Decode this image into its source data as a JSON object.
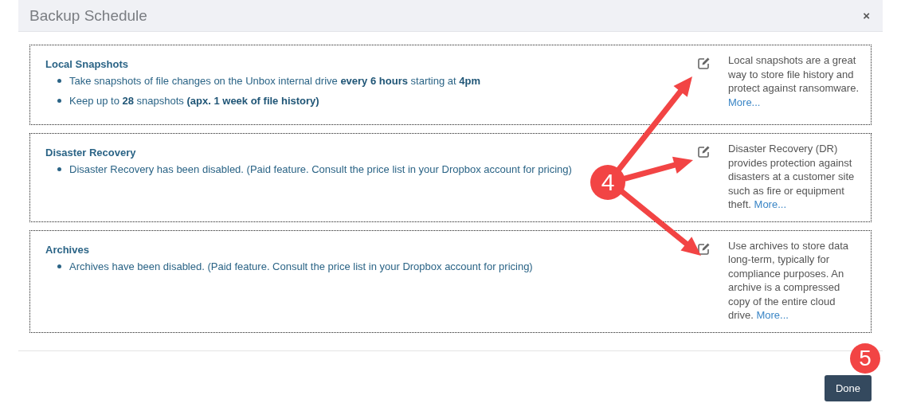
{
  "dialog": {
    "title": "Backup Schedule",
    "close": "×"
  },
  "sections": [
    {
      "title": "Local Snapshots",
      "bullets": [
        "Take snapshots of file changes on the Unbox internal drive **every 6 hours** starting at **4pm**",
        "Keep up to **28** snapshots **(apx. 1 week of file history)**"
      ],
      "description": "Local snapshots are a great way to store file history and protect against ransomware.",
      "link": "More..."
    },
    {
      "title": "Disaster Recovery",
      "bullets": [
        "Disaster Recovery has been disabled. (Paid feature. Consult the price list in your Dropbox account for pricing)"
      ],
      "description": "Disaster Recovery (DR) provides protection against disasters at a customer site such as fire or equipment theft.",
      "link": "More..."
    },
    {
      "title": "Archives",
      "bullets": [
        "Archives have been disabled. (Paid feature. Consult the price list in your Dropbox account for pricing)"
      ],
      "description": "Use archives to store data long-term, typically for compliance purposes. An archive is a compressed copy of the entire cloud drive.",
      "link": "More..."
    }
  ],
  "done_button": "Done",
  "callouts": [
    "4",
    "5"
  ]
}
